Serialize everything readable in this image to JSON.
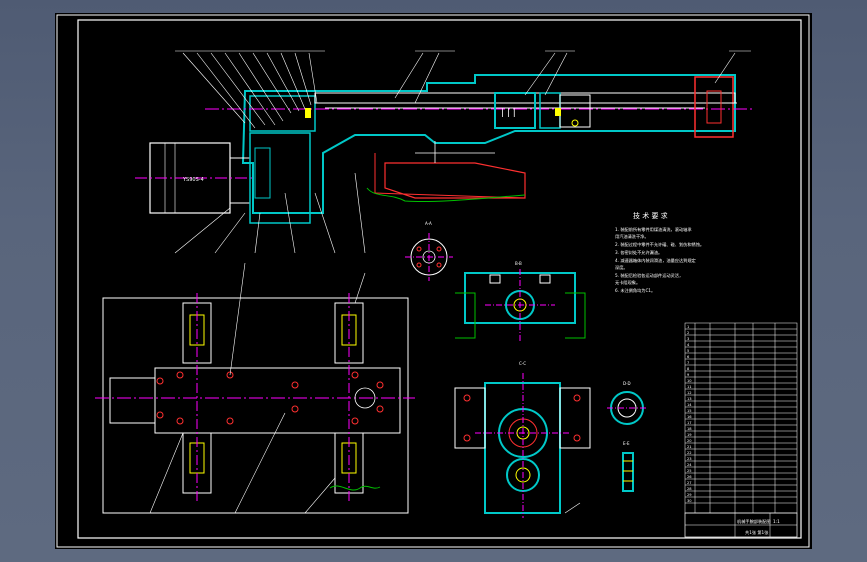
{
  "drawing": {
    "sheet_format": "A2",
    "technical_requirements": {
      "title": "技 术 要 求",
      "items": [
        "1. 装配前所有零件用煤油清洗，滚动轴承",
        "   用汽油清洗干净。",
        "2. 装配过程中零件不允许磕、碰、划伤和锈蚀。",
        "3. 各密封处不允许漏油。",
        "4. 减速器箱体内装润滑油，油量应达到规定",
        "   深度。",
        "5. 装配后检验各运动部件运动灵活，",
        "   无卡阻现象。",
        "6. 未注倒角均为C1。"
      ]
    },
    "section_labels": [
      "A-A",
      "B-B",
      "C-C",
      "D-D",
      "E-E"
    ],
    "motor_label": "YS90S-4",
    "title_block": {
      "name": "机械手腕部装配图",
      "scale": "1:1",
      "sheet": "共1张 第1张"
    },
    "bom_rows": [
      "1",
      "2",
      "3",
      "4",
      "5",
      "6",
      "7",
      "8",
      "9",
      "10",
      "11",
      "12",
      "13",
      "14",
      "15",
      "16",
      "17",
      "18",
      "19",
      "20",
      "21",
      "22",
      "23",
      "24",
      "25",
      "26",
      "27",
      "28",
      "29",
      "30"
    ]
  },
  "colors": {
    "background": "#000000",
    "frame": "#ffffff",
    "section_hatch": "#00c8c8",
    "center_line": "#ff00ff",
    "dimension": "#ffffff",
    "hidden_line": "#ff3030",
    "break_line": "#00c000",
    "highlight": "#ffff00"
  }
}
